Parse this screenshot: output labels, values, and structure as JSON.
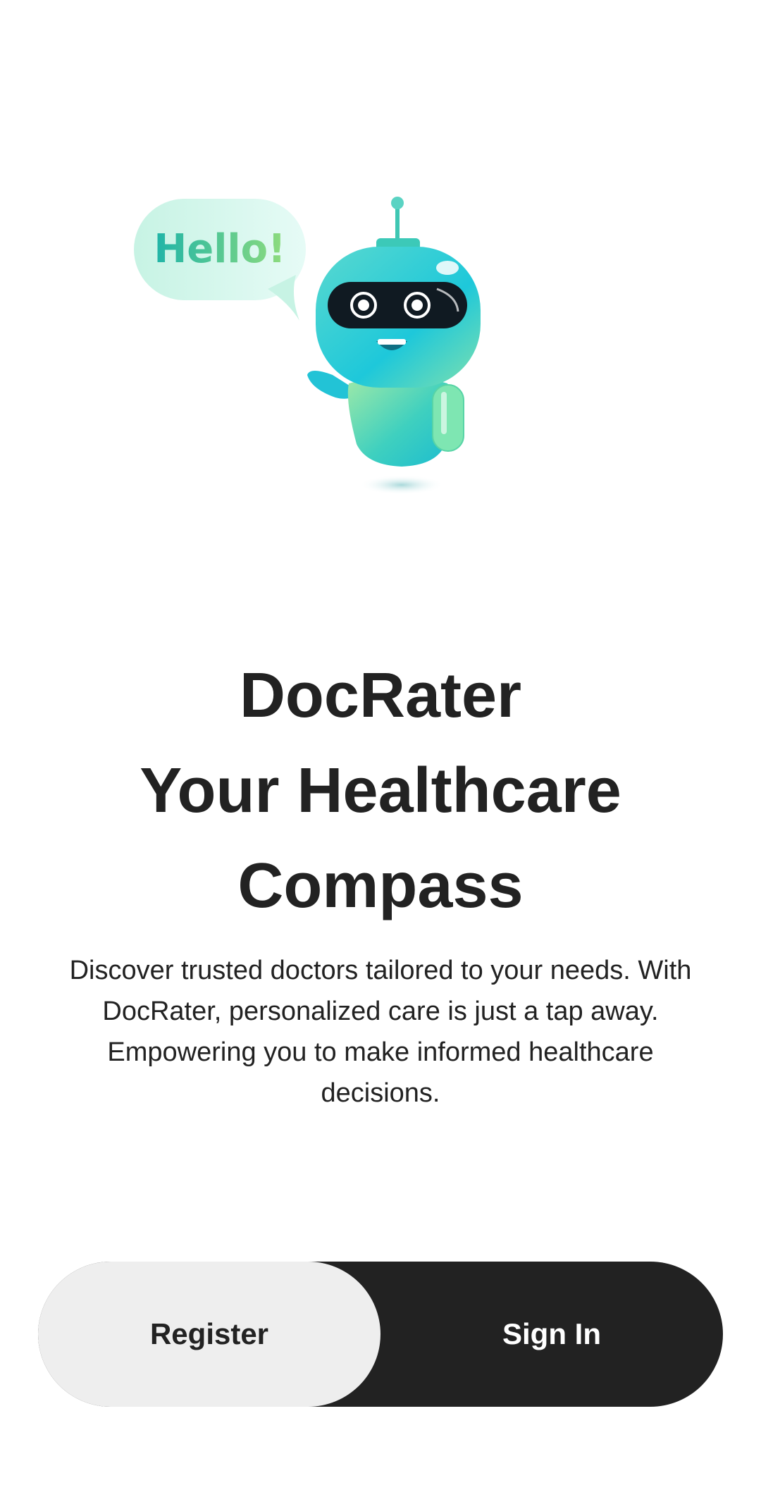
{
  "illustration": {
    "bubble_text": "Hello!",
    "icon": "robot-mascot-icon",
    "accent_color": "#2bc7c9",
    "secondary_color": "#8ee3a6"
  },
  "hero": {
    "title_line1": "DocRater",
    "title_line2": "Your Healthcare",
    "title_line3": "Compass",
    "description": "Discover trusted doctors tailored to your needs. With DocRater, personalized care is just a tap away. Empowering you to make informed healthcare decisions."
  },
  "actions": {
    "register_label": "Register",
    "signin_label": "Sign In"
  },
  "colors": {
    "dark": "#222222",
    "light_button": "#eeeeee",
    "background": "#ffffff"
  }
}
